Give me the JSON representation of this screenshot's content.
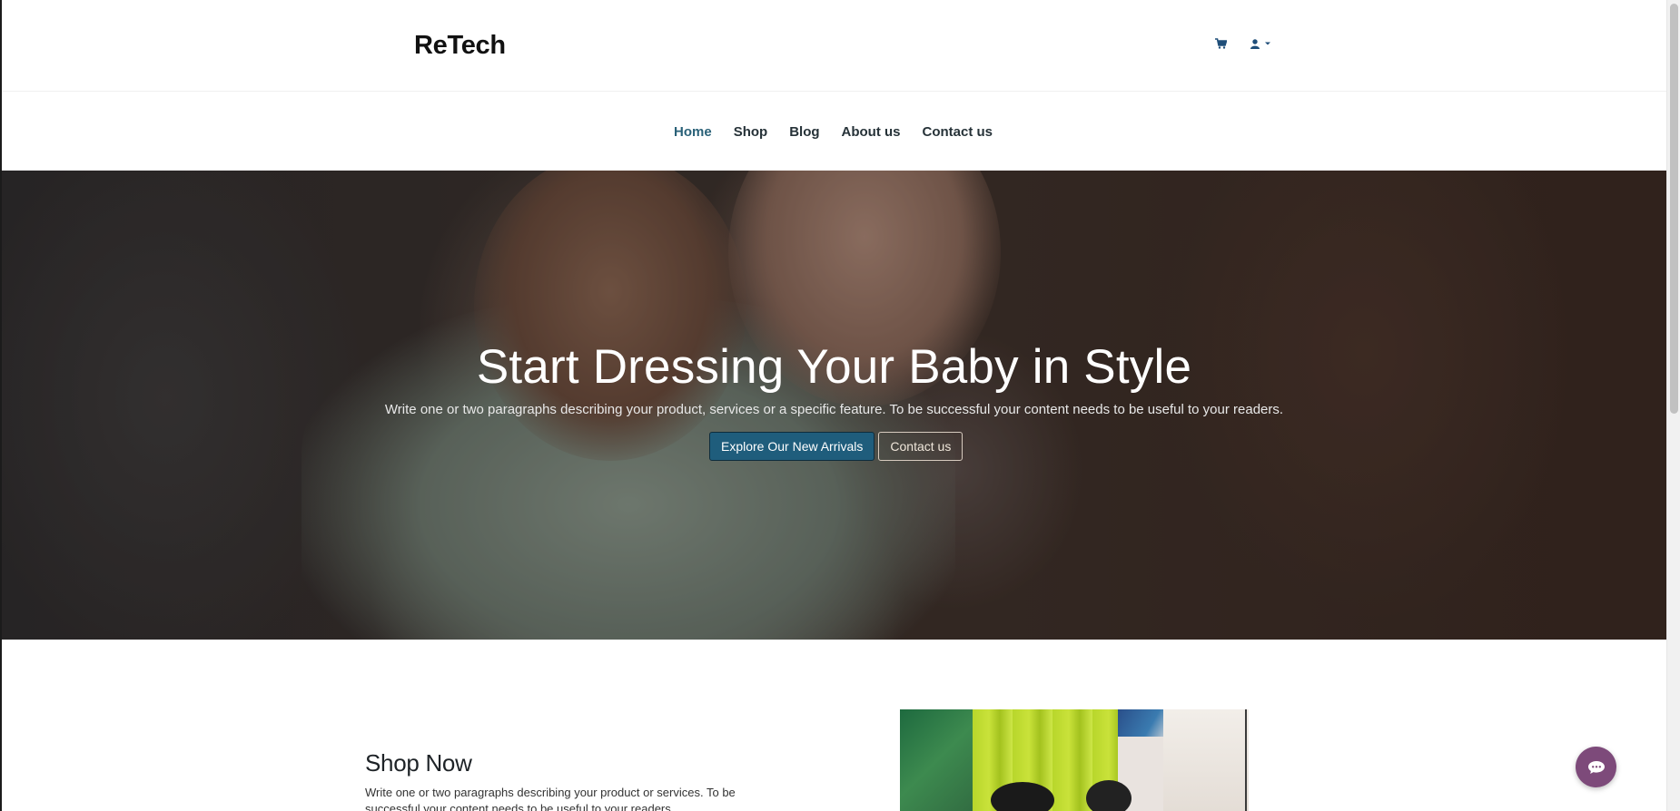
{
  "header": {
    "brand": "ReTech"
  },
  "nav": {
    "items": [
      {
        "label": "Home",
        "active": true
      },
      {
        "label": "Shop",
        "active": false
      },
      {
        "label": "Blog",
        "active": false
      },
      {
        "label": "About us",
        "active": false
      },
      {
        "label": "Contact us",
        "active": false
      }
    ]
  },
  "hero": {
    "title": "Start Dressing Your Baby in Style",
    "text": "Write one or two paragraphs describing your product, services or a specific feature. To be successful your content needs to be useful to your readers.",
    "primary_button": "Explore Our New Arrivals",
    "secondary_button": "Contact us"
  },
  "shop": {
    "title": "Shop Now",
    "text": "Write one or two paragraphs describing your product or services. To be successful your content needs to be useful to your readers."
  },
  "icons": {
    "cart": "shopping-cart-icon",
    "user": "user-icon",
    "dropdown": "caret-down-icon",
    "chat": "chat-icon"
  },
  "colors": {
    "accent": "#1f5d7c",
    "nav_active": "#2a6178",
    "chat_bubble": "#7d4a7a"
  }
}
